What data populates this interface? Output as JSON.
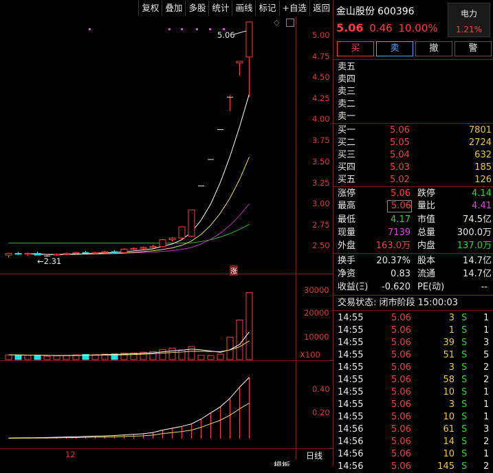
{
  "toolbar": {
    "buttons": [
      "复权",
      "叠加",
      "多股",
      "统计",
      "画线",
      "标记",
      "+自选",
      "返回"
    ]
  },
  "chart": {
    "price_axis": [
      "5.00",
      "4.75",
      "4.50",
      "4.25",
      "4.00",
      "3.75",
      "3.50",
      "3.25",
      "3.00",
      "2.75",
      "2.50"
    ],
    "high_label": "5.06",
    "low_label": "2.31",
    "limit_tag": "涨",
    "volume_axis": [
      "30000",
      "20000",
      "10000"
    ],
    "volume_unit": "X100",
    "indicator_axis": [
      "0.40",
      "0.20"
    ],
    "date_label": "12",
    "period_label": "日线",
    "bottom_tab": "模板"
  },
  "quote": {
    "name": "金山股份",
    "code": "600396",
    "sector": "电力",
    "sector_change": "1.21%",
    "price": "5.06",
    "change": "0.46",
    "change_pct": "10.00%",
    "buttons": {
      "buy": "买",
      "sell": "卖",
      "cancel": "撤",
      "alert": "警"
    },
    "asks": [
      {
        "label": "卖五",
        "price": "",
        "vol": ""
      },
      {
        "label": "卖四",
        "price": "",
        "vol": ""
      },
      {
        "label": "卖三",
        "price": "",
        "vol": ""
      },
      {
        "label": "卖二",
        "price": "",
        "vol": ""
      },
      {
        "label": "卖一",
        "price": "",
        "vol": ""
      }
    ],
    "bids": [
      {
        "label": "买一",
        "price": "5.06",
        "vol": "7801"
      },
      {
        "label": "买二",
        "price": "5.05",
        "vol": "2724"
      },
      {
        "label": "买三",
        "price": "5.04",
        "vol": "632"
      },
      {
        "label": "买四",
        "price": "5.03",
        "vol": "185"
      },
      {
        "label": "买五",
        "price": "5.02",
        "vol": "126"
      }
    ],
    "stats": {
      "limit_up_label": "涨停",
      "limit_up": "5.06",
      "limit_down_label": "跌停",
      "limit_down": "4.14",
      "high_label": "最高",
      "high": "5.06",
      "vol_ratio_label": "量比",
      "vol_ratio": "4.41",
      "low_label": "最低",
      "low": "4.17",
      "mcap_label": "市值",
      "mcap": "74.5亿",
      "curvol_label": "现量",
      "curvol": "7139",
      "totvol_label": "总量",
      "totvol": "300.0万",
      "outer_label": "外盘",
      "outer": "163.0万",
      "inner_label": "内盘",
      "inner": "137.0万",
      "turnover_label": "换手",
      "turnover": "20.37%",
      "equity_label": "股本",
      "equity": "14.7亿",
      "nav_label": "净资",
      "nav": "0.83",
      "float_label": "流通",
      "float": "14.7亿",
      "eps_label": "收益(Ξ)",
      "eps": "-0.620",
      "pe_label": "PE(动)",
      "pe": "--"
    },
    "status": "交易状态: 闭市阶段 15:00:03",
    "ticks": [
      {
        "time": "14:55",
        "price": "5.06",
        "vol": "3",
        "side": "S",
        "n": "1"
      },
      {
        "time": "14:55",
        "price": "5.06",
        "vol": "1",
        "side": "S",
        "n": "1"
      },
      {
        "time": "14:55",
        "price": "5.06",
        "vol": "39",
        "side": "S",
        "n": "3"
      },
      {
        "time": "14:55",
        "price": "5.06",
        "vol": "51",
        "side": "S",
        "n": "5"
      },
      {
        "time": "14:55",
        "price": "5.06",
        "vol": "3",
        "side": "S",
        "n": "2"
      },
      {
        "time": "14:55",
        "price": "5.06",
        "vol": "58",
        "side": "S",
        "n": "2"
      },
      {
        "time": "14:55",
        "price": "5.06",
        "vol": "10",
        "side": "S",
        "n": "1"
      },
      {
        "time": "14:55",
        "price": "5.06",
        "vol": "3",
        "side": "S",
        "n": "1"
      },
      {
        "time": "14:55",
        "price": "5.06",
        "vol": "10",
        "side": "S",
        "n": "1"
      },
      {
        "time": "14:56",
        "price": "5.06",
        "vol": "61",
        "side": "S",
        "n": "3"
      },
      {
        "time": "14:56",
        "price": "5.06",
        "vol": "14",
        "side": "S",
        "n": "2"
      },
      {
        "time": "14:56",
        "price": "5.06",
        "vol": "10",
        "side": "S",
        "n": "1"
      },
      {
        "time": "14:56",
        "price": "5.06",
        "vol": "145",
        "side": "S",
        "n": "2"
      }
    ]
  },
  "chart_data": {
    "type": "candlestick",
    "candles": [
      {
        "o": 2.33,
        "h": 2.36,
        "l": 2.3,
        "c": 2.35
      },
      {
        "o": 2.35,
        "h": 2.37,
        "l": 2.33,
        "c": 2.34
      },
      {
        "o": 2.34,
        "h": 2.36,
        "l": 2.32,
        "c": 2.35
      },
      {
        "o": 2.35,
        "h": 2.37,
        "l": 2.33,
        "c": 2.33
      },
      {
        "o": 2.32,
        "h": 2.34,
        "l": 2.31,
        "c": 2.32
      },
      {
        "o": 2.33,
        "h": 2.35,
        "l": 2.32,
        "c": 2.34
      },
      {
        "o": 2.34,
        "h": 2.36,
        "l": 2.33,
        "c": 2.35
      },
      {
        "o": 2.35,
        "h": 2.37,
        "l": 2.34,
        "c": 2.36
      },
      {
        "o": 2.36,
        "h": 2.38,
        "l": 2.35,
        "c": 2.35
      },
      {
        "o": 2.35,
        "h": 2.37,
        "l": 2.34,
        "c": 2.36
      },
      {
        "o": 2.36,
        "h": 2.38,
        "l": 2.35,
        "c": 2.37
      },
      {
        "o": 2.37,
        "h": 2.39,
        "l": 2.36,
        "c": 2.36
      },
      {
        "o": 2.36,
        "h": 2.41,
        "l": 2.35,
        "c": 2.4
      },
      {
        "o": 2.4,
        "h": 2.42,
        "l": 2.39,
        "c": 2.41
      },
      {
        "o": 2.41,
        "h": 2.43,
        "l": 2.4,
        "c": 2.42
      },
      {
        "o": 2.42,
        "h": 2.45,
        "l": 2.41,
        "c": 2.43
      },
      {
        "o": 2.43,
        "h": 2.52,
        "l": 2.42,
        "c": 2.51
      },
      {
        "o": 2.51,
        "h": 2.54,
        "l": 2.49,
        "c": 2.53
      },
      {
        "o": 2.53,
        "h": 2.66,
        "l": 2.52,
        "c": 2.66
      },
      {
        "o": 2.55,
        "h": 2.86,
        "l": 2.54,
        "c": 2.86
      },
      {
        "o": 3.14,
        "h": 3.14,
        "l": 3.14,
        "c": 3.14
      },
      {
        "o": 3.45,
        "h": 3.45,
        "l": 3.45,
        "c": 3.45
      },
      {
        "o": 3.8,
        "h": 3.8,
        "l": 3.8,
        "c": 3.8
      },
      {
        "o": 4.18,
        "h": 4.2,
        "l": 4.02,
        "c": 4.18
      },
      {
        "o": 4.58,
        "h": 4.6,
        "l": 4.43,
        "c": 4.6
      },
      {
        "o": 4.65,
        "h": 5.06,
        "l": 4.18,
        "c": 5.06
      }
    ],
    "price_range": [
      2.25,
      5.1
    ],
    "volume": [
      2100,
      2000,
      1900,
      1800,
      1500,
      1700,
      1900,
      2100,
      2300,
      2200,
      2400,
      2500,
      2800,
      3000,
      3300,
      3600,
      4500,
      5100,
      4300,
      5800,
      1900,
      1800,
      2400,
      10000,
      17600,
      29800
    ],
    "volume_range": [
      0,
      34000
    ],
    "indicator": [
      0.005,
      0.006,
      0.007,
      0.008,
      0.009,
      0.011,
      0.013,
      0.015,
      0.018,
      0.02,
      0.022,
      0.025,
      0.03,
      0.035,
      0.04,
      0.05,
      0.07,
      0.085,
      0.1,
      0.12,
      0.16,
      0.21,
      0.26,
      0.33,
      0.42,
      0.5
    ],
    "indicator_range": [
      0,
      0.55
    ]
  }
}
